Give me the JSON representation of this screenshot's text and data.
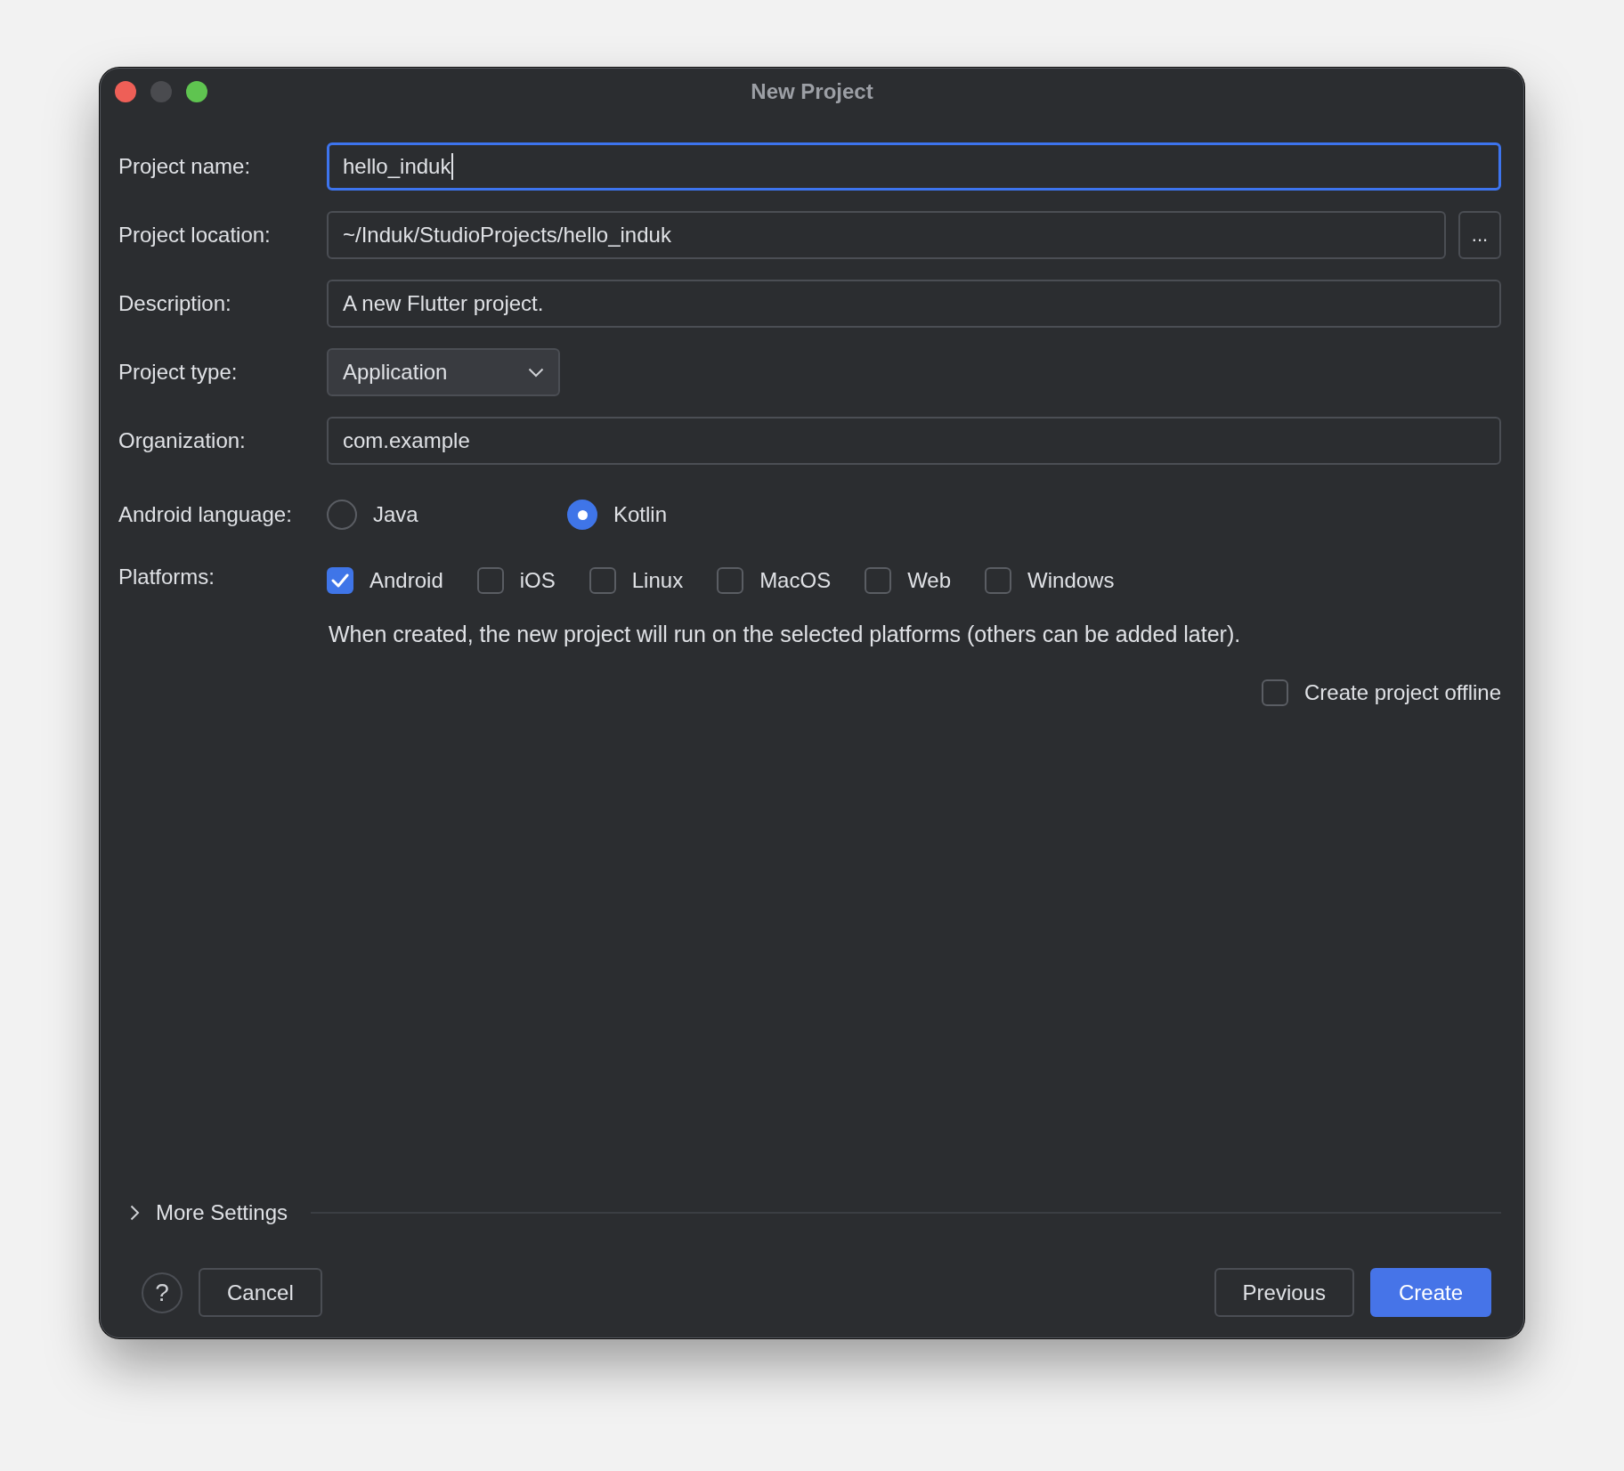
{
  "window": {
    "title": "New Project"
  },
  "fields": [
    {
      "kind": "text",
      "label": "Project name:",
      "value": "hello_induk",
      "focused": true
    },
    {
      "kind": "path",
      "label": "Project location:",
      "value": "~/Induk/StudioProjects/hello_induk",
      "button": "...",
      "focused": false
    },
    {
      "kind": "text",
      "label": "Description:",
      "value": "A new Flutter project.",
      "focused": false
    },
    {
      "kind": "dropdown",
      "label": "Project type:",
      "value": "Application",
      "focused": false
    },
    {
      "kind": "text",
      "label": "Organization:",
      "value": "com.example",
      "focused": false
    }
  ],
  "android_language": {
    "label": "Android language:",
    "options": [
      {
        "label": "Java",
        "selected": false
      },
      {
        "label": "Kotlin",
        "selected": true
      }
    ]
  },
  "platforms": {
    "label": "Platforms:",
    "options": [
      {
        "label": "Android",
        "checked": true
      },
      {
        "label": "iOS",
        "checked": false
      },
      {
        "label": "Linux",
        "checked": false
      },
      {
        "label": "MacOS",
        "checked": false
      },
      {
        "label": "Web",
        "checked": false
      },
      {
        "label": "Windows",
        "checked": false
      }
    ],
    "note": "When created, the new project will run on the selected platforms (others can be added later)."
  },
  "offline": {
    "label": "Create project offline",
    "checked": false
  },
  "more_settings": {
    "label": "More Settings",
    "expanded": false
  },
  "buttons": {
    "help": "?",
    "cancel": "Cancel",
    "previous": "Previous",
    "create": "Create"
  }
}
